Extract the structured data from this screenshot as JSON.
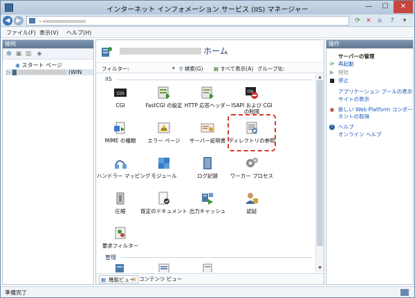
{
  "window": {
    "title": "インターネット インフォメーション サービス (IIS) マネージャー",
    "min": "—",
    "max": "☐",
    "close": "✕"
  },
  "address": {
    "text": "▸ ▪▪▪▪▪▪▪▪▪▪▪▪▪▪",
    "chevron": "▸"
  },
  "menu": [
    "ファイル(F)",
    "表示(V)",
    "ヘルプ(H)"
  ],
  "connections": {
    "header": "接続",
    "tree": [
      {
        "label": "スタート ページ"
      },
      {
        "label": "(WIN"
      }
    ]
  },
  "center": {
    "title": "ホーム",
    "filter": {
      "label": "フィルター:",
      "search": "検索(G)",
      "show_all": "すべて表示(A)",
      "group": "グループ化:"
    },
    "groups": [
      "IIS",
      "管理"
    ],
    "features": [
      {
        "label": "CGI"
      },
      {
        "label": "FastCGI の設定"
      },
      {
        "label": "HTTP 応答ヘッダー"
      },
      {
        "label": "ISAPI および CGI\nの制限"
      },
      {
        "label": "MIME の種類"
      },
      {
        "label": "エラー ページ"
      },
      {
        "label": "サーバー証明書"
      },
      {
        "label": "ディレクトリの参照"
      },
      {
        "label": "ハンドラー マッピング"
      },
      {
        "label": "モジュール"
      },
      {
        "label": "ログ記録"
      },
      {
        "label": "ワーカー プロセス"
      },
      {
        "label": "圧縮"
      },
      {
        "label": "既定のドキュメント"
      },
      {
        "label": "出力キャッシュ"
      },
      {
        "label": "認証"
      },
      {
        "label": "要求フィルター"
      }
    ],
    "view_tabs": [
      "機能ビュー",
      "コンテンツ ビュー"
    ]
  },
  "actions": {
    "header": "操作",
    "section": "サーバーの管理",
    "items": [
      {
        "label": "再起動",
        "state": "link"
      },
      {
        "label": "開始",
        "state": "disabled"
      },
      {
        "label": "停止",
        "state": "link"
      },
      {
        "label": "アプリケーション プールの表示",
        "state": "link"
      },
      {
        "label": "サイトの表示",
        "state": "link"
      },
      {
        "label": "新しい Web Platform コンポー",
        "state": "link"
      },
      {
        "label": "ネントの取得",
        "state": "link"
      },
      {
        "label": "ヘルプ",
        "state": "link"
      },
      {
        "label": "オンライン ヘルプ",
        "state": "link"
      }
    ]
  },
  "status": {
    "text": "準備完了"
  },
  "colors": {
    "accent": "#1c56b8",
    "highlight": "#e0302a",
    "pane_header": "#6b84a0"
  }
}
